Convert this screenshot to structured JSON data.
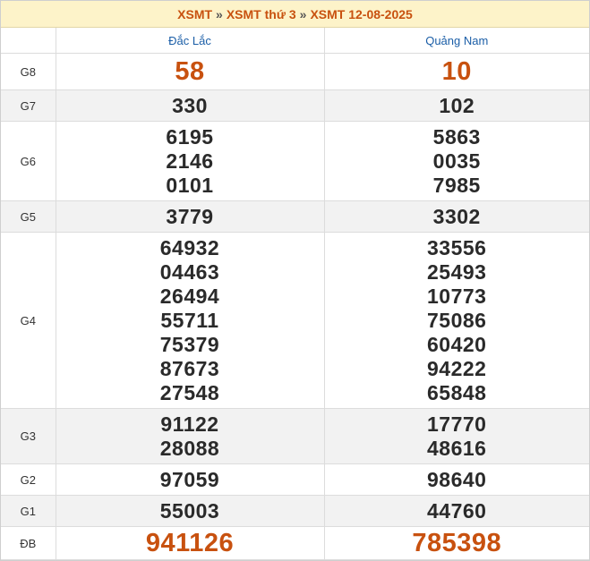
{
  "breadcrumb": {
    "link1": "XSMT",
    "link2": "XSMT thứ 3",
    "link3": "XSMT 12-08-2025",
    "separator": "»"
  },
  "provinces": [
    "Đắc Lắc",
    "Quảng Nam"
  ],
  "prizes": [
    {
      "label": "G8",
      "values": [
        [
          "58"
        ],
        [
          "10"
        ]
      ]
    },
    {
      "label": "G7",
      "values": [
        [
          "330"
        ],
        [
          "102"
        ]
      ]
    },
    {
      "label": "G6",
      "values": [
        [
          "6195",
          "2146",
          "0101"
        ],
        [
          "5863",
          "0035",
          "7985"
        ]
      ]
    },
    {
      "label": "G5",
      "values": [
        [
          "3779"
        ],
        [
          "3302"
        ]
      ]
    },
    {
      "label": "G4",
      "values": [
        [
          "64932",
          "04463",
          "26494",
          "55711",
          "75379",
          "87673",
          "27548"
        ],
        [
          "33556",
          "25493",
          "10773",
          "75086",
          "60420",
          "94222",
          "65848"
        ]
      ]
    },
    {
      "label": "G3",
      "values": [
        [
          "91122",
          "28088"
        ],
        [
          "17770",
          "48616"
        ]
      ]
    },
    {
      "label": "G2",
      "values": [
        [
          "97059"
        ],
        [
          "98640"
        ]
      ]
    },
    {
      "label": "G1",
      "values": [
        [
          "55003"
        ],
        [
          "44760"
        ]
      ]
    },
    {
      "label": "ĐB",
      "values": [
        [
          "941126"
        ],
        [
          "785398"
        ]
      ]
    }
  ],
  "colors": {
    "accent": "#c8510f",
    "province": "#1b5ea7",
    "header_bg": "#fdf3c9",
    "alt_row": "#f2f2f2"
  }
}
